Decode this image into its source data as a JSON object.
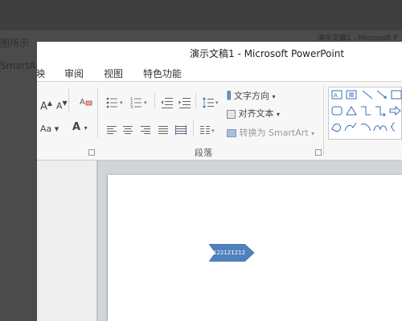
{
  "background": {
    "line1_fragment": "图所示",
    "line2_fragment": "SmartA",
    "corner_title": "演示文稿1 - Microsoft P"
  },
  "window": {
    "title": "演示文稿1 - Microsoft PowerPoint"
  },
  "tabs": [
    {
      "label": "映"
    },
    {
      "label": "审阅"
    },
    {
      "label": "视图"
    },
    {
      "label": "特色功能"
    }
  ],
  "ribbon": {
    "paragraph": {
      "text_direction": "文字方向",
      "align_text": "对齐文本",
      "convert_smartart": "转换为 SmartArt",
      "group_label": "段落"
    },
    "font": {
      "grow": "A",
      "shrink": "A",
      "case": "Aa",
      "color": "A"
    }
  },
  "slide": {
    "shape_text": "122121212"
  },
  "colors": {
    "shape_fill": "#4f81bd",
    "ribbon_bg": "#f7f7f7",
    "workspace_bg": "#d1d4d9"
  }
}
